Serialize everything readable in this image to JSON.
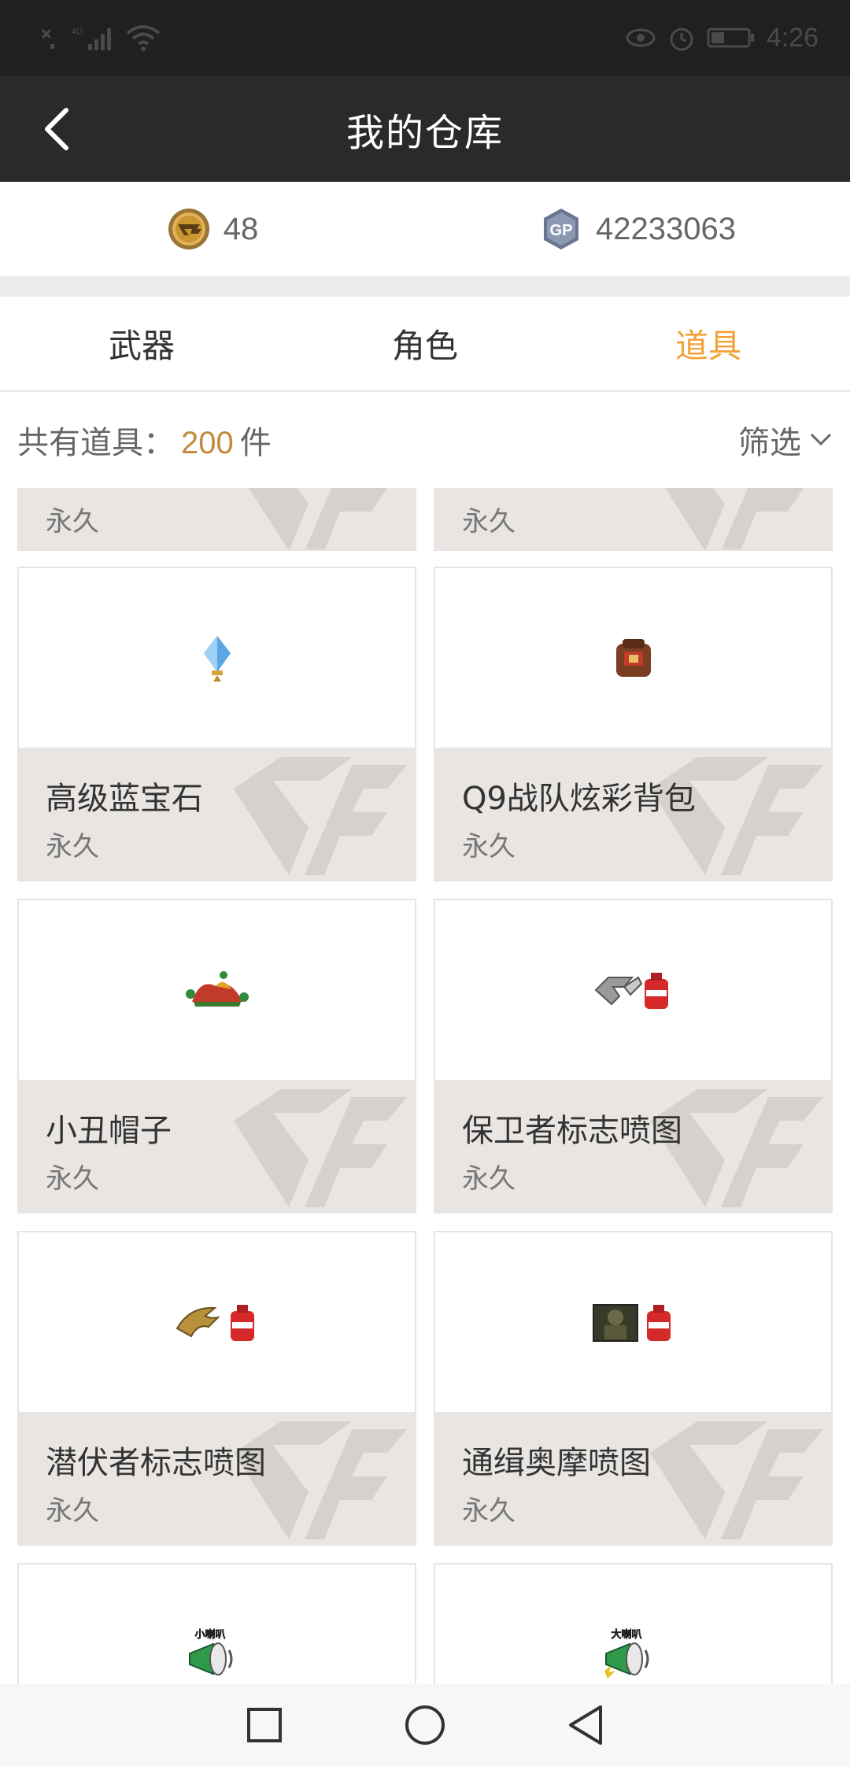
{
  "status_bar": {
    "time": "4:26",
    "network_badge": "4G",
    "icons": [
      "sim-x-icon",
      "signal-icon",
      "wifi-icon",
      "eye-icon",
      "alarm-icon",
      "battery-icon"
    ]
  },
  "header": {
    "title": "我的仓库",
    "back_icon": "chevron-left-icon"
  },
  "currency": {
    "cf_points": "48",
    "gp_points": "42233063",
    "gp_badge": "GP"
  },
  "tabs": [
    {
      "label": "武器",
      "active": false
    },
    {
      "label": "角色",
      "active": false
    },
    {
      "label": "道具",
      "active": true
    }
  ],
  "summary": {
    "prefix": "共有道具：",
    "count": "200",
    "suffix": "件",
    "filter_label": "筛选"
  },
  "items": [
    {
      "name": "",
      "duration": "永久",
      "icon": "partial-item"
    },
    {
      "name": "",
      "duration": "永久",
      "icon": "partial-item"
    },
    {
      "name": "高级蓝宝石",
      "duration": "永久",
      "icon": "sapphire-icon"
    },
    {
      "name": "Q9战队炫彩背包",
      "duration": "永久",
      "icon": "backpack-icon"
    },
    {
      "name": "小丑帽子",
      "duration": "永久",
      "icon": "jester-hat-icon"
    },
    {
      "name": "保卫者标志喷图",
      "duration": "永久",
      "icon": "spray-defender-icon"
    },
    {
      "name": "潜伏者标志喷图",
      "duration": "永久",
      "icon": "spray-lurker-icon"
    },
    {
      "name": "通缉奥摩喷图",
      "duration": "永久",
      "icon": "spray-wanted-icon"
    },
    {
      "name": "",
      "duration": "",
      "icon": "small-horn-icon",
      "badge": "小喇叭"
    },
    {
      "name": "",
      "duration": "",
      "icon": "big-horn-icon",
      "badge": "大喇叭"
    }
  ],
  "colors": {
    "accent": "#f2a238",
    "count": "#c28a3a",
    "header_bg": "#2a2a2a",
    "card_info_bg": "#e8e5e2"
  }
}
